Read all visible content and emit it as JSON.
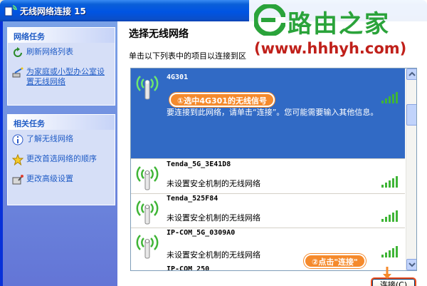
{
  "window": {
    "title": "无线网络连接 15"
  },
  "network_tasks": {
    "header": "网络任务",
    "items": [
      {
        "label": "刷新网络列表"
      },
      {
        "label": "为家庭或小型办公室设置无线网络"
      }
    ]
  },
  "related_tasks": {
    "header": "相关任务",
    "items": [
      {
        "label": "了解无线网络"
      },
      {
        "label": "更改首选网络的顺序"
      },
      {
        "label": "更改高级设置"
      }
    ]
  },
  "content": {
    "heading": "选择无线网络",
    "instructions": "单击以下列表中的项目以连接到区"
  },
  "networks": [
    {
      "ssid": "4G301",
      "description": "要连接到此网络，请单击“连接”。您可能需要输入其他信息。",
      "selected": true,
      "signal": 5
    },
    {
      "ssid": "Tenda_5G_3E41D8",
      "description": "未设置安全机制的无线网络",
      "selected": false,
      "signal": 5
    },
    {
      "ssid": "Tenda_525F84",
      "description": "未设置安全机制的无线网络",
      "selected": false,
      "signal": 5
    },
    {
      "ssid": "IP-COM_5G_0309A0",
      "description": "未设置安全机制的无线网络",
      "selected": false,
      "signal": 5
    },
    {
      "ssid": "IP-COM_250",
      "description": "",
      "selected": false,
      "signal": 5
    }
  ],
  "connect_button": {
    "label": "连接(C)"
  },
  "annotations": {
    "step1": "①选中4G301的无线信号",
    "step2": "②点击\"连接\""
  },
  "watermark": {
    "name": "路由之家",
    "url": "(www.hhhyh.com)"
  },
  "colors": {
    "selection": "#316ac5",
    "titlebar": "#0054e3",
    "task_link": "#215dc6",
    "annotation": "#f58a2c",
    "signal_green": "#3fb536"
  }
}
